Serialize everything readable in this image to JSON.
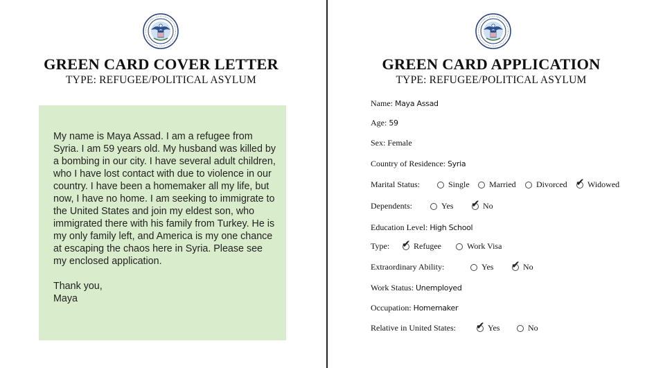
{
  "cover_letter": {
    "title": "GREEN CARD COVER LETTER",
    "subtitle": "TYPE: REFUGEE/POLITICAL ASYLUM",
    "body": "My name is Maya Assad. I am a refugee from Syria. I am 59 years old. My husband was killed by a bombing in our city. I have several adult children, who I have lost contact with due to violence in our country. I have been a homemaker all my life, but now, I have no home. I am seeking to immigrate to the United States and join my eldest son, who immigrated there with his family from Turkey. He is my only family left, and America is my one chance at escaping the chaos here in Syria. Please see my enclosed application.",
    "closing": "Thank you,",
    "signature": "Maya"
  },
  "application": {
    "title": "GREEN CARD APPLICATION",
    "subtitle": "TYPE: REFUGEE/POLITICAL ASYLUM",
    "name": {
      "label": "Name:",
      "value": "Maya Assad"
    },
    "age": {
      "label": "Age:",
      "value": "59"
    },
    "sex": {
      "label": "Sex:",
      "value": "Female"
    },
    "country": {
      "label": "Country of Residence:",
      "value": "Syria"
    },
    "marital": {
      "label": "Marital Status:",
      "options": [
        "Single",
        "Married",
        "Divorced",
        "Widowed"
      ],
      "selected": "Widowed"
    },
    "dependents": {
      "label": "Dependents:",
      "options": [
        "Yes",
        "No"
      ],
      "selected": "No"
    },
    "education": {
      "label": "Education Level:",
      "value": "High School"
    },
    "type": {
      "label": "Type:",
      "options": [
        "Refugee",
        "Work Visa"
      ],
      "selected": "Refugee"
    },
    "ability": {
      "label": "Extraordinary Ability:",
      "options": [
        "Yes",
        "No"
      ],
      "selected": "No"
    },
    "work": {
      "label": "Work Status:",
      "value": "Unemployed"
    },
    "occupation": {
      "label": "Occupation:",
      "value": "Homemaker"
    },
    "relative": {
      "label": "Relative in United States:",
      "options": [
        "Yes",
        "No"
      ],
      "selected": "Yes"
    }
  },
  "seal": {
    "text": "U.S. DEPARTMENT OF HOMELAND SECURITY",
    "color_outer": "#1f3c7a",
    "color_eagle": "#2c4f8e"
  },
  "colors": {
    "letter_background": "#d9edcc",
    "divider": "#222222"
  }
}
